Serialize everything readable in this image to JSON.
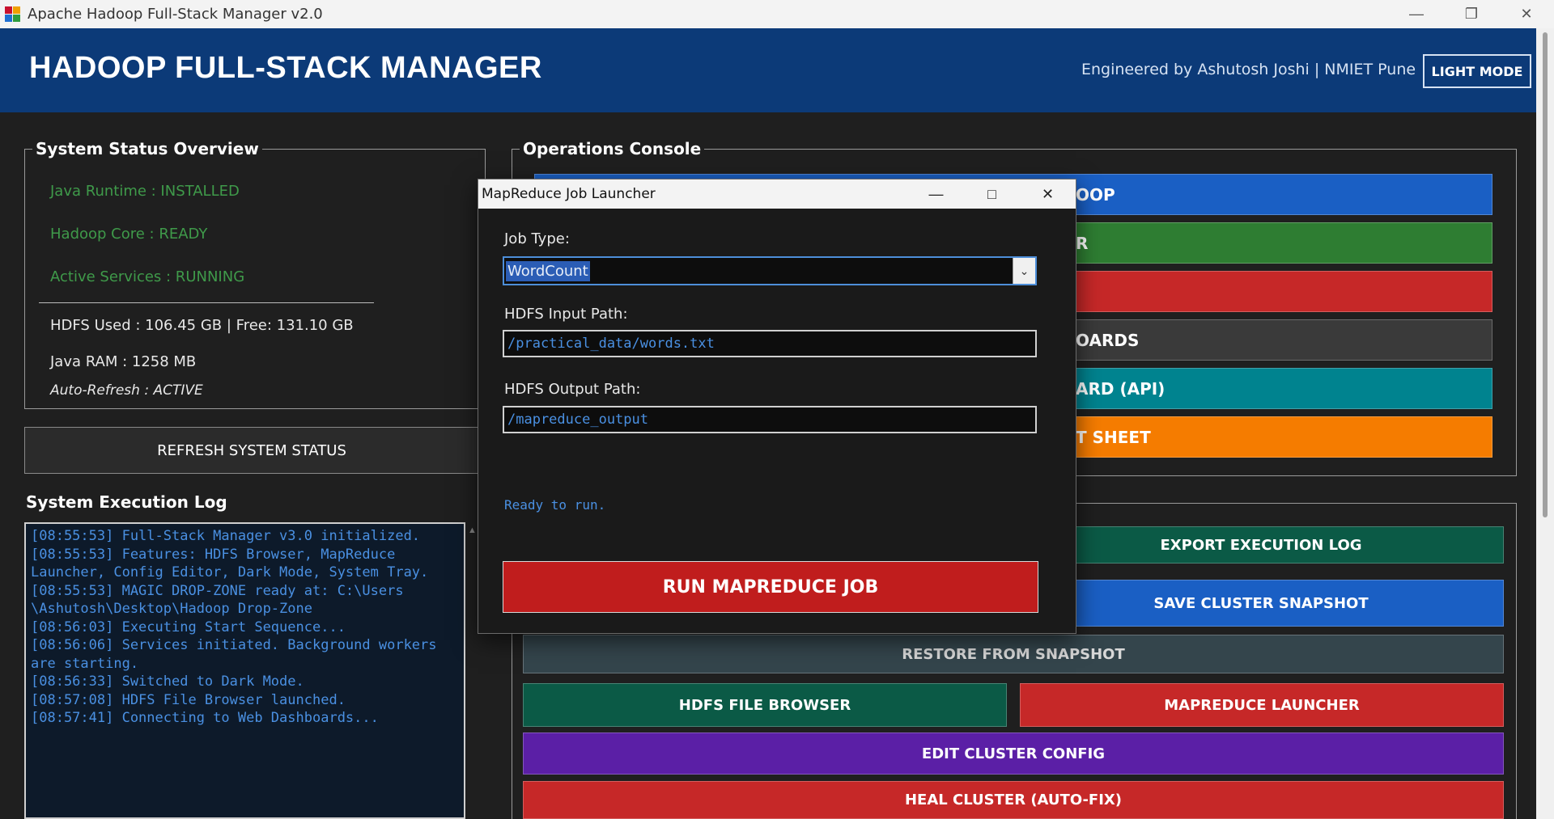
{
  "window": {
    "title": "Apache Hadoop Full-Stack Manager v2.0",
    "minimize_icon": "minimize-icon",
    "restore_icon": "restore-icon",
    "close_icon": "close-icon"
  },
  "header": {
    "brand": "HADOOP FULL-STACK MANAGER",
    "credit": "Engineered by Ashutosh Joshi | NMIET Pune",
    "mode_button": "LIGHT MODE"
  },
  "status": {
    "group_title": "System Status Overview",
    "java_runtime": "Java Runtime : INSTALLED",
    "hadoop_core": "Hadoop Core : READY",
    "active_services": "Active Services : RUNNING",
    "hdfs_used": "HDFS Used : 106.45 GB | Free: 131.10 GB",
    "java_ram": "Java RAM : 1258 MB",
    "auto_refresh": "Auto-Refresh : ACTIVE"
  },
  "refresh_button": "REFRESH SYSTEM STATUS",
  "log": {
    "title": "System Execution Log",
    "lines": [
      "[08:55:53] Full-Stack Manager v3.0 initialized.",
      "[08:55:53] Features: HDFS Browser, MapReduce",
      "Launcher, Config Editor, Dark Mode, System Tray.",
      "[08:55:53] MAGIC DROP-ZONE ready at: C:\\Users",
      "\\Ashutosh\\Desktop\\Hadoop Drop-Zone",
      "[08:56:03] Executing Start Sequence...",
      "[08:56:06] Services initiated. Background workers",
      "are starting.",
      "[08:56:33] Switched to Dark Mode.",
      "[08:57:08] HDFS File Browser launched.",
      "[08:57:41] Connecting to Web Dashboards..."
    ]
  },
  "operations": {
    "group_title": "Operations Console",
    "btn1": "OOP",
    "btn2": "R",
    "btn3": "",
    "btn4": "OARDS",
    "btn5": "ARD (API)",
    "btn6": "T SHEET"
  },
  "tools": {
    "export_log": "EXPORT EXECUTION LOG",
    "save_snapshot": "SAVE CLUSTER SNAPSHOT",
    "restore_snapshot": "RESTORE FROM SNAPSHOT",
    "hdfs_browser": "HDFS FILE BROWSER",
    "mapreduce_launcher": "MAPREDUCE LAUNCHER",
    "edit_config": "EDIT CLUSTER CONFIG",
    "heal_cluster": "HEAL CLUSTER (AUTO-FIX)"
  },
  "dialog": {
    "title": "MapReduce Job Launcher",
    "job_type_label": "Job Type:",
    "job_type_value": "WordCount",
    "input_label": "HDFS Input Path:",
    "input_value": "/practical_data/words.txt",
    "output_label": "HDFS Output Path:",
    "output_value": "/mapreduce_output",
    "status": "Ready to run.",
    "run_button": "RUN MAPREDUCE JOB"
  },
  "colors": {
    "header_bg": "#0c3a78",
    "blue": "#1a5fc4",
    "green": "#2e7d32",
    "red": "#c62828",
    "gray": "#3a3a3a",
    "teal": "#00838f",
    "orange": "#f57c00",
    "dark_green": "#0b5a46",
    "slate": "#34454c",
    "purple": "#5b1fa6"
  }
}
